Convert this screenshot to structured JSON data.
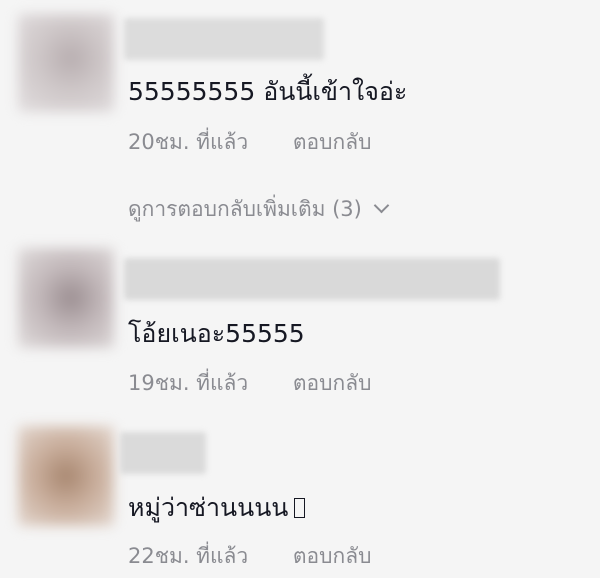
{
  "comments": [
    {
      "text": "55555555 อันนี้เข้าใจอ่ะ",
      "time": "20ชม. ที่แล้ว",
      "reply_label": "ตอบกลับ",
      "view_more": "ดูการตอบกลับเพิ่มเติม (3)"
    },
    {
      "text": "โอ้ยเนอะ55555",
      "time": "19ชม. ที่แล้ว",
      "reply_label": "ตอบกลับ"
    },
    {
      "text": "หมู่ว่าซ่านนนน",
      "time": "22ชม. ที่แล้ว",
      "reply_label": "ตอบกลับ"
    }
  ]
}
